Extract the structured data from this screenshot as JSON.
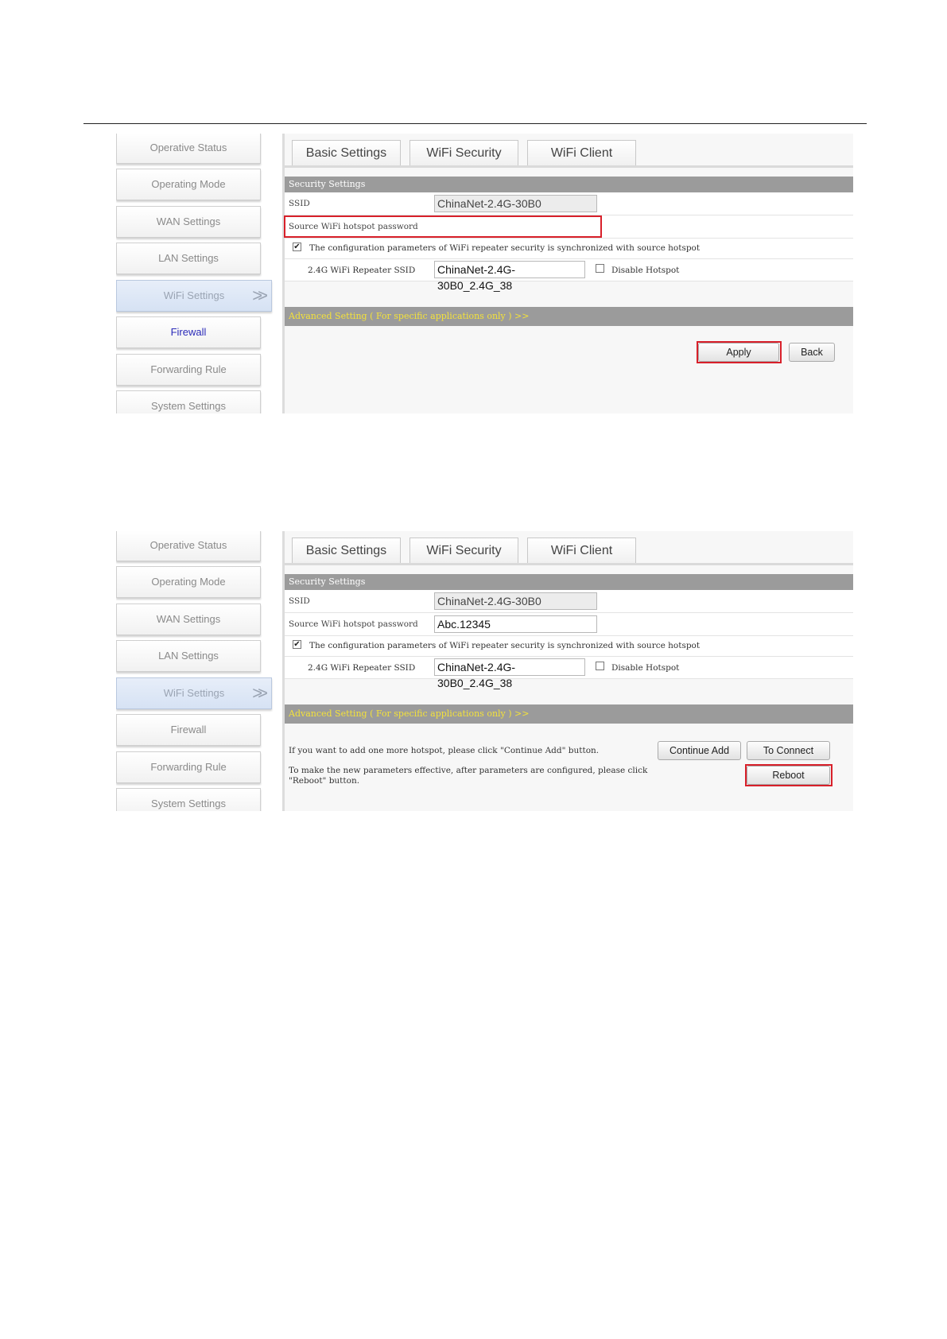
{
  "nav": {
    "items": [
      {
        "label": "Operative Status"
      },
      {
        "label": "Operating Mode"
      },
      {
        "label": "WAN Settings"
      },
      {
        "label": "LAN Settings"
      },
      {
        "label": "WiFi Settings",
        "arrow": ">>"
      },
      {
        "label": "Firewall"
      },
      {
        "label": "Forwarding Rule"
      },
      {
        "label": "System Settings"
      }
    ]
  },
  "tabs": [
    "Basic Settings",
    "WiFi Security",
    "WiFi Client"
  ],
  "section_title": "Security Settings",
  "labels": {
    "ssid": "SSID",
    "source_password": "Source WiFi hotspot password",
    "sync_text": "The configuration parameters of WiFi repeater security is synchronized with source hotspot",
    "repeater_ssid": "2.4G WiFi Repeater SSID",
    "disable_hotspot": "Disable Hotspot",
    "advanced": "Advanced Setting ( For specific applications only ) >>"
  },
  "values": {
    "ssid": "ChinaNet-2.4G-30B0",
    "repeater_ssid": "ChinaNet-2.4G-30B0_2.4G_38",
    "password_screen1": "",
    "password_screen2": "Abc.12345",
    "sync_checked": "✔",
    "disable_hotspot_checked": ""
  },
  "screen1": {
    "apply": "Apply",
    "back": "Back"
  },
  "screen2": {
    "continue_text": "If you want to add one more hotspot, please click \"Continue Add\" button.",
    "continue_button": "Continue Add",
    "connect_button": "To Connect",
    "reboot_text_1": "To make the new parameters effective, after parameters are configured, please click",
    "reboot_text_2": "\"Reboot\" button.",
    "reboot_button": "Reboot"
  },
  "colors": {
    "highlight": "#d8202a",
    "section_bar": "#9b9b9b",
    "advanced_text": "#f4e23a",
    "firewall_link": "#2a2ab8"
  }
}
